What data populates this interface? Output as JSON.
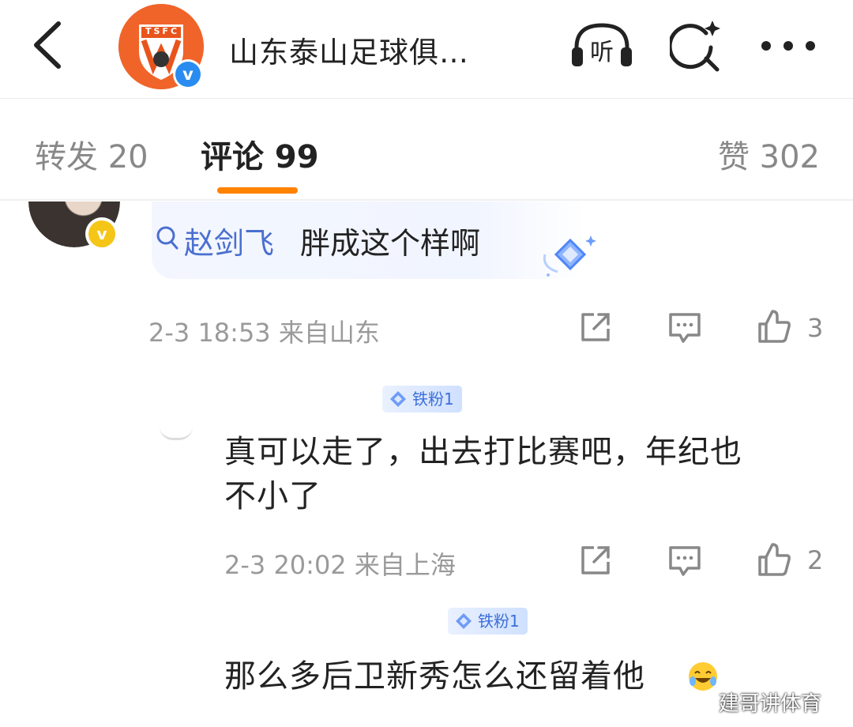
{
  "header": {
    "title": "山东泰山足球俱…",
    "logo_text": "TSFC",
    "verified_mark": "v",
    "accent": "#f0642a"
  },
  "tabs": [
    {
      "label": "转发 20"
    },
    {
      "label": "评论 99"
    },
    {
      "label": "赞 302"
    }
  ],
  "comments": [
    {
      "vip_mark": "v",
      "search_link": "赵剑飞",
      "text": "胖成这个样啊",
      "time_location": "2-3 18:53  来自山东",
      "likes": "3"
    },
    {
      "fan_badge": "铁粉1",
      "text_line1": "真可以走了，出去打比赛吧，年纪也",
      "text_line2": "不小了",
      "time_location": "2-3 20:02  来自上海",
      "likes": "2"
    },
    {
      "fan_badge": "铁粉1",
      "text": "那么多后卫新秀怎么还留着他"
    }
  ],
  "watermark": "建哥讲体育",
  "icons": {
    "back": "chevron-left-icon",
    "listen": "headphones-listen-icon",
    "search": "search-sparkle-icon",
    "more": "more-dots-icon",
    "repost": "share-icon",
    "comment": "comment-icon",
    "like": "thumbs-up-icon"
  },
  "colors": {
    "tab_active_underline": "#ff8200",
    "link": "#4a6fcf",
    "verified": "#2a8cf0",
    "vip": "#f5c518"
  }
}
